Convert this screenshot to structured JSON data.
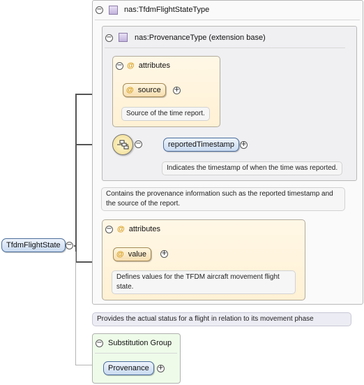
{
  "root_element": {
    "label": "TfdmFlightState",
    "note": "Provides the actual status for a flight in relation to its movement phase"
  },
  "type": {
    "label": "nas:TfdmFlightStateType",
    "note": "Contains the provenance information such as the reported timestamp and the source of the report."
  },
  "base": {
    "label": "nas:ProvenanceType (extension base)",
    "attributes_label": "attributes",
    "source": {
      "label": "source",
      "note": "Source of the time report."
    },
    "reported_timestamp": {
      "label": "reportedTimestamp",
      "note": "Indicates the timestamp of when the time was reported."
    }
  },
  "type_attributes": {
    "label": "attributes",
    "value": {
      "label": "value",
      "note": "Defines values for the TFDM aircraft movement flight state."
    }
  },
  "substitution_group": {
    "label": "Substitution Group",
    "member": "Provenance"
  },
  "icons": {
    "toggle_collapse": "minus-circle-icon",
    "toggle_expand": "plus-circle-icon",
    "attribute": "at-sign-icon",
    "type": "complex-type-icon",
    "sequence": "sequence-compositor-icon"
  },
  "colors": {
    "element_pill": "#c9daf0",
    "attribute_pill": "#f6deb0",
    "attribute_group_bg": "#fff1d4",
    "substitution_bg": "#eefbe9",
    "attr_symbol": "#d59a14"
  },
  "glyphs": {
    "minus": "−",
    "plus": "+",
    "at": "@"
  }
}
